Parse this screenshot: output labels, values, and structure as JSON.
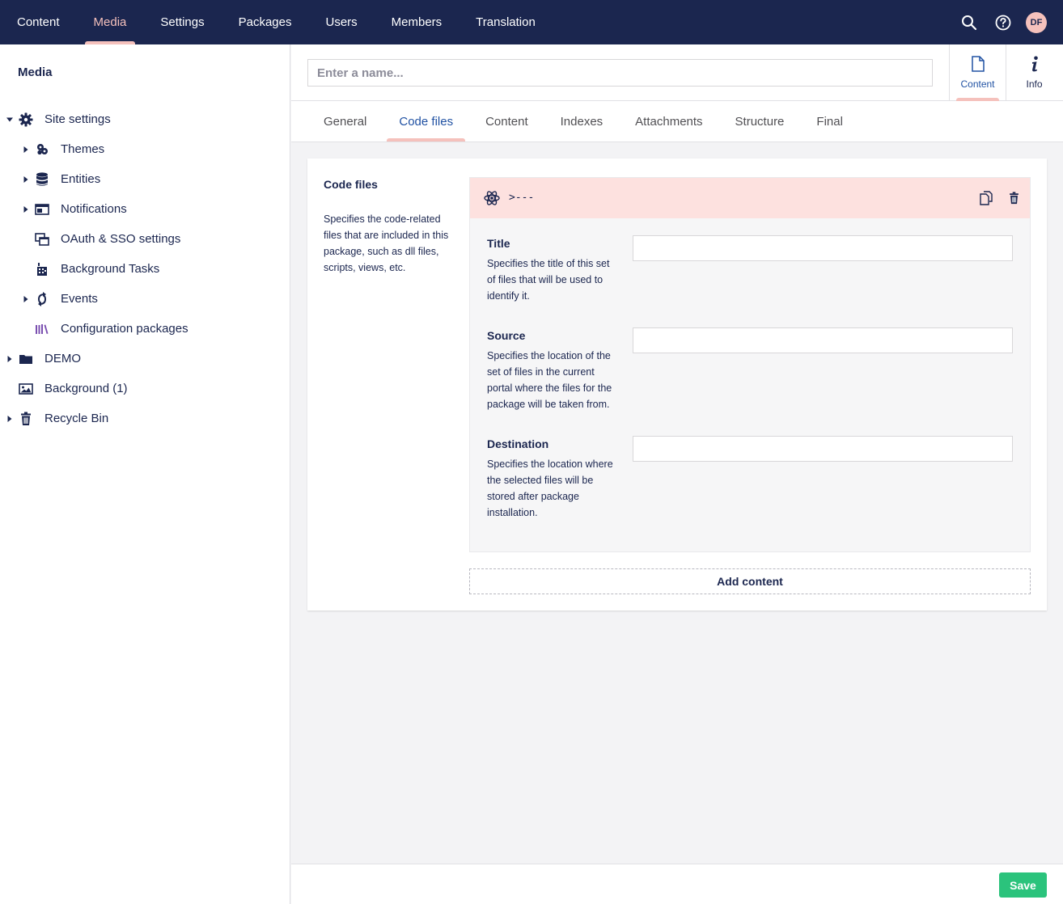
{
  "topnav": {
    "items": [
      "Content",
      "Media",
      "Settings",
      "Packages",
      "Users",
      "Members",
      "Translation"
    ],
    "active": "Media",
    "avatar_initials": "DF",
    "icons": [
      "search-icon",
      "help-icon"
    ]
  },
  "sidebar": {
    "title": "Media",
    "tree": [
      {
        "label": "Site settings",
        "icon": "gear-icon",
        "expanded": true
      },
      {
        "label": "Themes",
        "icon": "palette-icon"
      },
      {
        "label": "Entities",
        "icon": "database-icon"
      },
      {
        "label": "Notifications",
        "icon": "window-icon"
      },
      {
        "label": "OAuth & SSO settings",
        "icon": "windows-icon"
      },
      {
        "label": "Background Tasks",
        "icon": "factory-icon"
      },
      {
        "label": "Events",
        "icon": "sync-icon"
      },
      {
        "label": "Configuration packages",
        "icon": "books-icon"
      },
      {
        "label": "DEMO",
        "icon": "folder-icon"
      },
      {
        "label": "Background (1)",
        "icon": "picture-icon"
      },
      {
        "label": "Recycle Bin",
        "icon": "trash-icon"
      }
    ]
  },
  "header": {
    "name_placeholder": "Enter a name...",
    "apps": [
      {
        "label": "Content",
        "icon": "document-icon",
        "active": true
      },
      {
        "label": "Info",
        "icon": "info-icon"
      }
    ]
  },
  "tabs": [
    "General",
    "Code files",
    "Content",
    "Indexes",
    "Attachments",
    "Structure",
    "Final"
  ],
  "active_tab": "Code files",
  "property": {
    "label": "Code files",
    "description": "Specifies the code-related files that are included in this package, such as dll files, scripts, views, etc."
  },
  "block": {
    "name": ">---",
    "icon": "atom-icon",
    "actions": [
      "copy-icon",
      "trash-icon"
    ],
    "fields": [
      {
        "label": "Title",
        "description": "Specifies the title of this set of files that will be used to identify it.",
        "value": ""
      },
      {
        "label": "Source",
        "description": "Specifies the location of the set of files in the current portal where the files for the package will be taken from.",
        "value": ""
      },
      {
        "label": "Destination",
        "description": "Specifies the location where the selected files will be stored after package installation.",
        "value": ""
      }
    ]
  },
  "add_content_label": "Add content",
  "footer": {
    "save_label": "Save"
  },
  "colors": {
    "nav_bg": "#1b264f",
    "accent": "#f5c1bc",
    "active_text": "#2152a3",
    "block_header": "#fde1df",
    "save": "#2bc37c"
  }
}
